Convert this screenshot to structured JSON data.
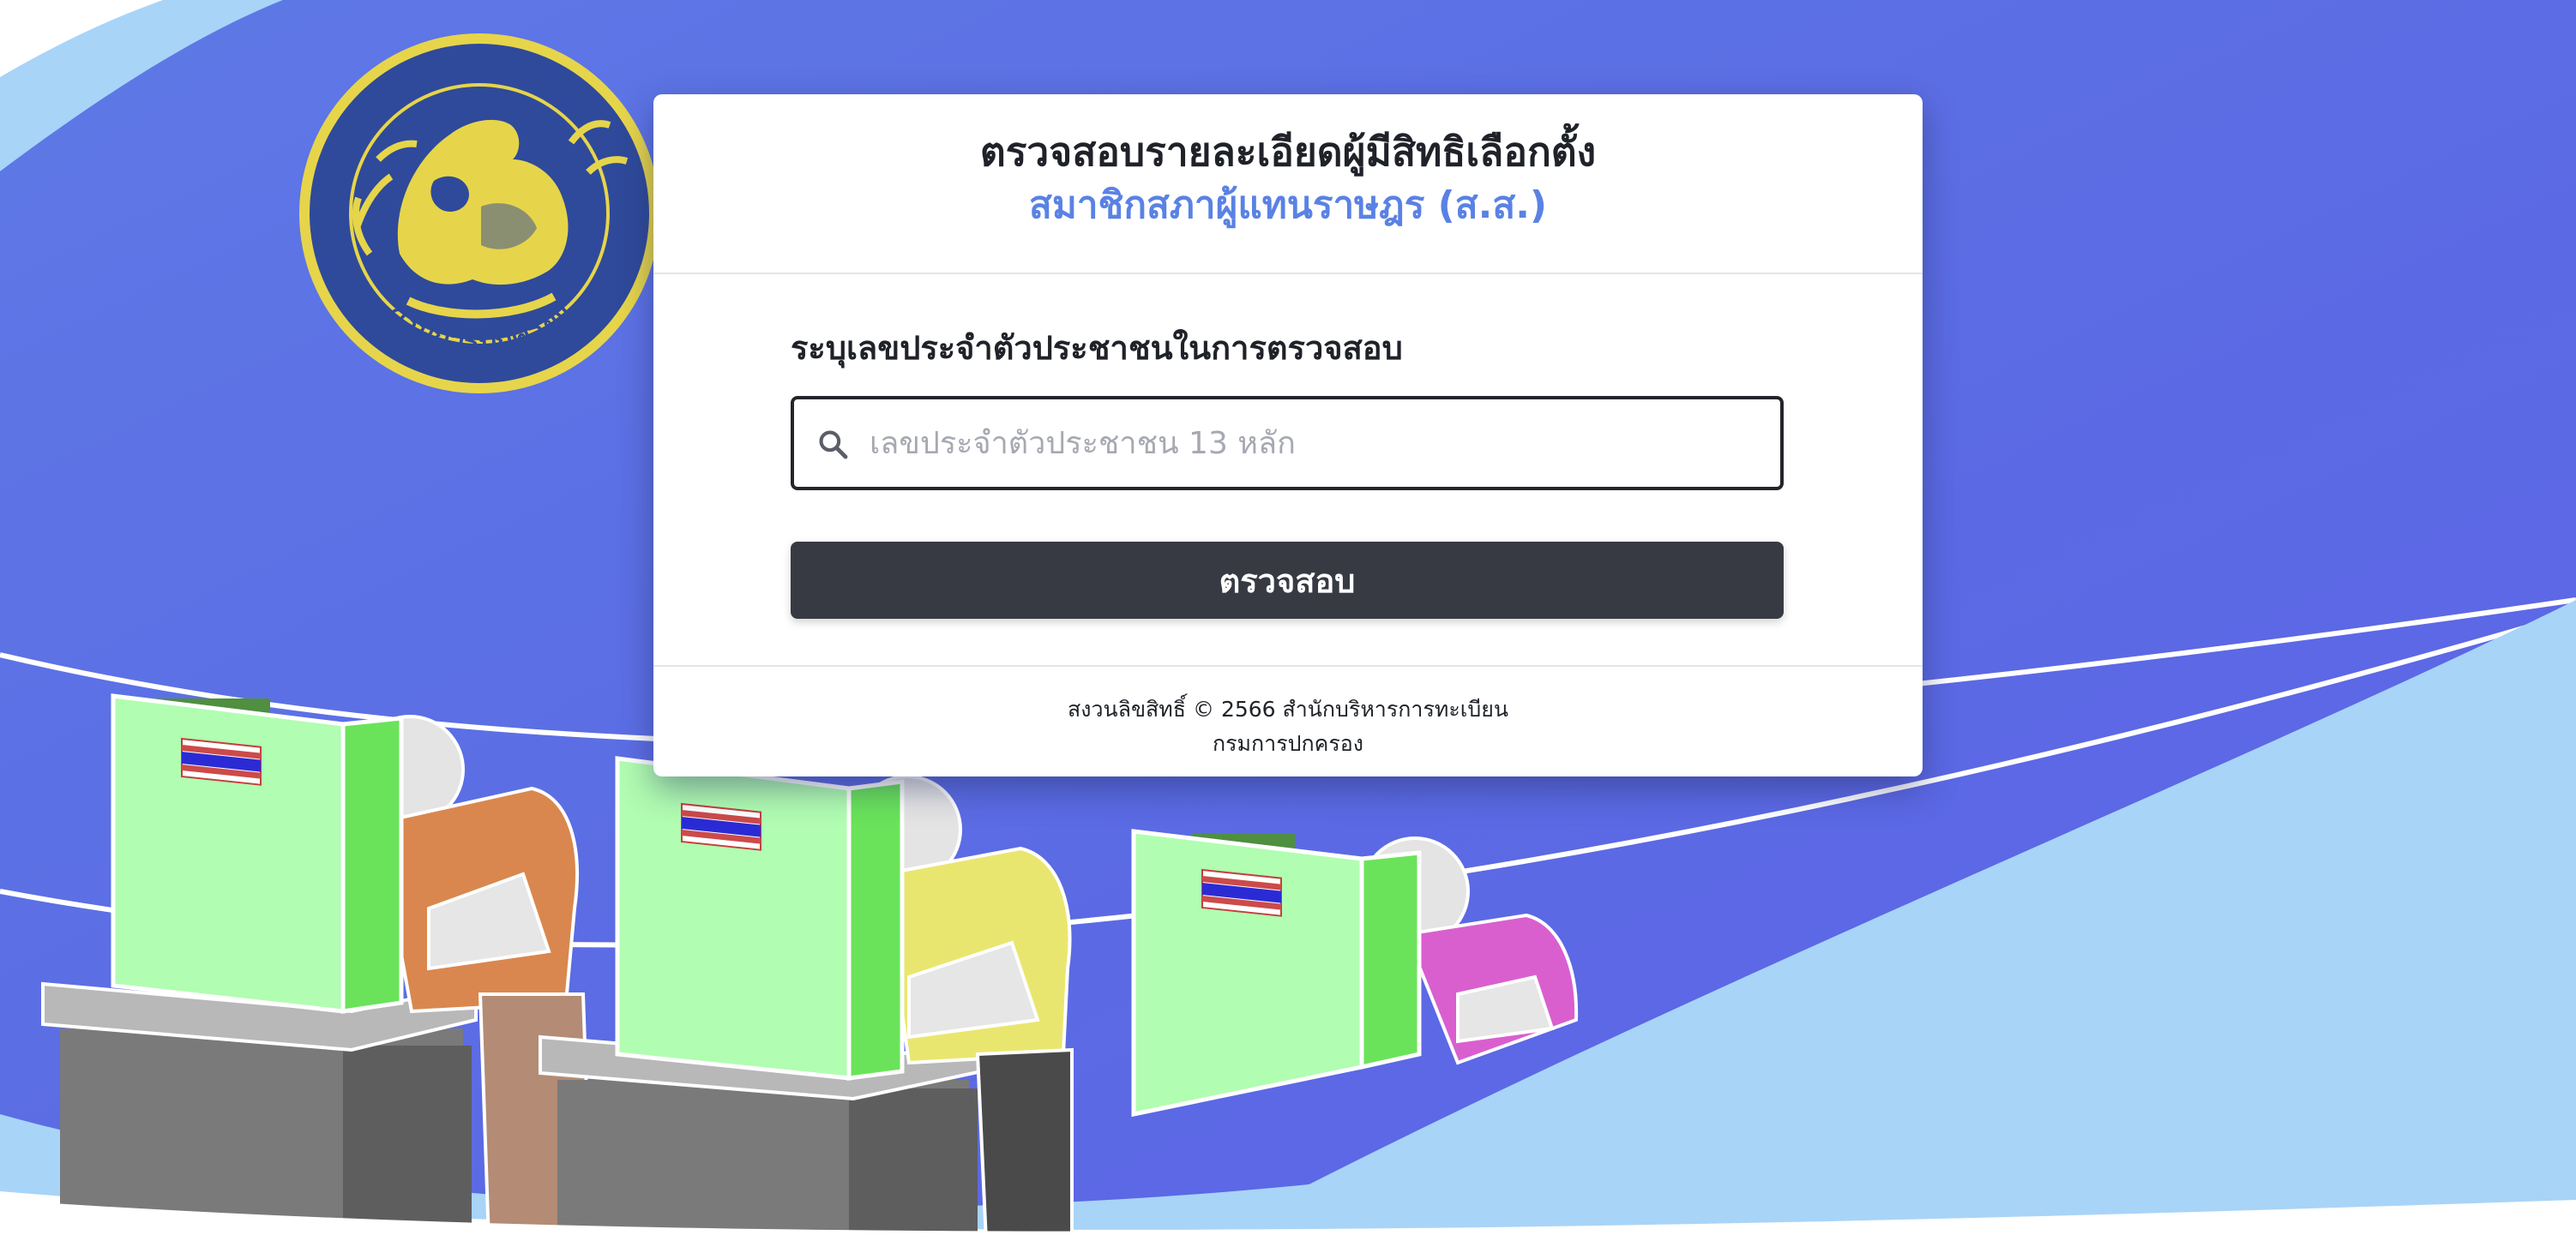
{
  "header": {
    "title_line1": "ตรวจสอบรายละเอียดผู้มีสิทธิเลือกตั้ง",
    "title_line2": "สมาชิกสภาผู้แทนราษฎร (ส.ส.)"
  },
  "form": {
    "label": "ระบุเลขประจำตัวประชาชนในการตรวจสอบ",
    "input_value": "",
    "input_placeholder": "เลขประจำตัวประชาชน 13 หลัก",
    "search_icon": "search-icon",
    "submit_label": "ตรวจสอบ"
  },
  "footer": {
    "line1": "สงวนลิขสิทธิ์ © 2566 สำนักบริหารการทะเบียน",
    "line2": "กรมการปกครอง"
  },
  "emblem": {
    "text": "กรมการปกครอง",
    "icon": "department-of-provincial-administration-seal"
  },
  "colors": {
    "accent": "#5a82e4",
    "button": "#373a43",
    "background_blue": "#5d6fe6",
    "background_light": "#a8d4f8"
  }
}
